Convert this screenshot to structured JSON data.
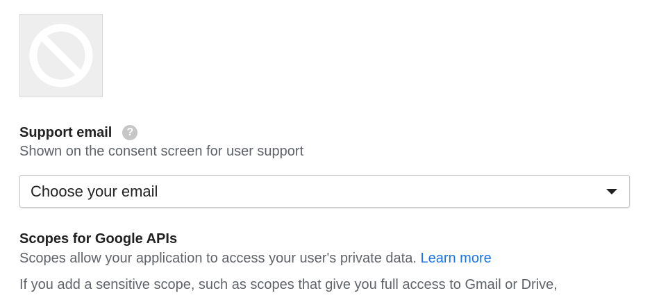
{
  "logo": {
    "icon": "no-image-placeholder-icon",
    "background": "#eeeeee"
  },
  "support_email": {
    "title": "Support email",
    "help_icon": "help-icon",
    "help_symbol": "?",
    "description": "Shown on the consent screen for user support",
    "select": {
      "value": "Choose your email"
    }
  },
  "scopes": {
    "title": "Scopes for Google APIs",
    "description": "Scopes allow your application to access your user's private data.",
    "learn_more": "Learn more",
    "sensitive_text": "If you add a sensitive scope, such as scopes that give you full access to Gmail or Drive,"
  },
  "colors": {
    "link": "#1a73e8",
    "text": "#212121",
    "secondary_text": "#5f6368",
    "help_icon": "#c6c6c6"
  }
}
